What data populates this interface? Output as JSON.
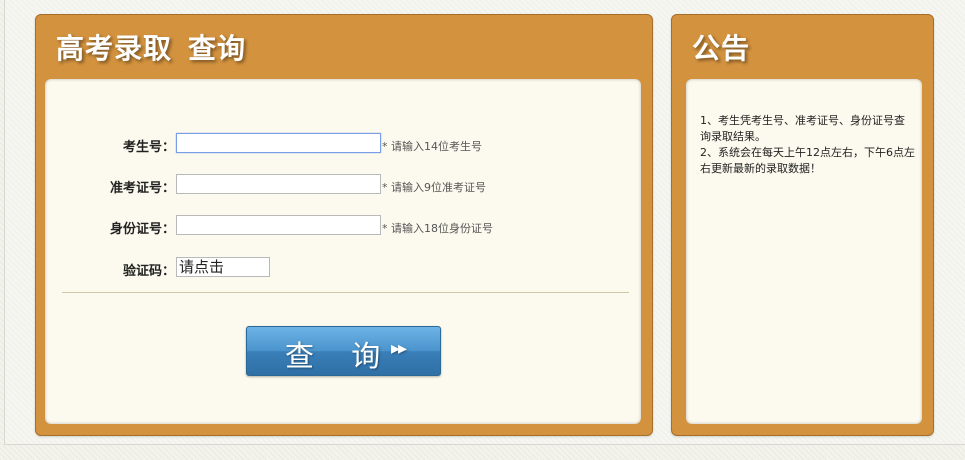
{
  "query_panel": {
    "title_part1": "高考录取",
    "title_part2": "查询",
    "fields": [
      {
        "label": "考生号：",
        "value": "",
        "hint": "* 请输入14位考生号"
      },
      {
        "label": "准考证号：",
        "value": "",
        "hint": "* 请输入9位准考证号"
      },
      {
        "label": "身份证号：",
        "value": "",
        "hint": "* 请输入18位身份证号"
      }
    ],
    "captcha": {
      "label": "验证码：",
      "text": "请点击"
    },
    "submit_label": "查 询",
    "submit_icon": "double-chevron-right-icon"
  },
  "notice_panel": {
    "title": "公告",
    "items": [
      "1、考生凭考生号、准考证号、身份证号查询录取结果。",
      "2、系统会在每天上午12点左右，下午6点左右更新最新的录取数据！"
    ]
  },
  "colors": {
    "panel_orange": "#d3923e",
    "panel_inner": "#fcfaee",
    "button_blue": "#3a86c4"
  }
}
